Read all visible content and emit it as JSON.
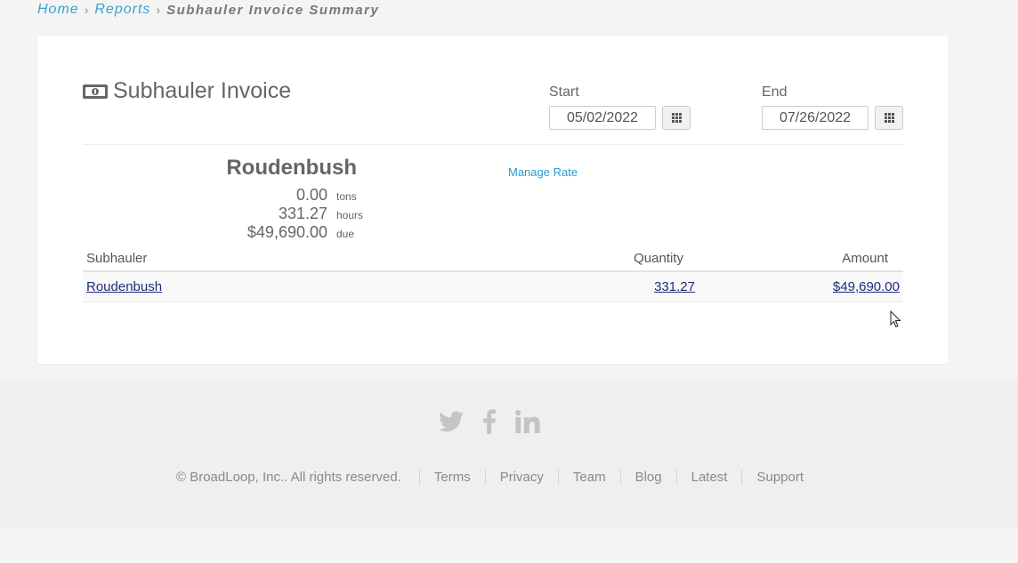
{
  "breadcrumb": {
    "home": "Home",
    "reports": "Reports",
    "current": "Subhauler Invoice Summary",
    "separator": "›"
  },
  "header": {
    "title": "Subhauler Invoice",
    "icon": "money-icon"
  },
  "dates": {
    "start_label": "Start",
    "start_value": "05/02/2022",
    "end_label": "End",
    "end_value": "07/26/2022",
    "calendar_icon": "calendar-grid-icon"
  },
  "summary": {
    "name": "Roudenbush",
    "tons_value": "0.00",
    "tons_unit": "tons",
    "hours_value": "331.27",
    "hours_unit": "hours",
    "due_value": "$49,690.00",
    "due_unit": "due",
    "manage_rate": "Manage Rate"
  },
  "table": {
    "columns": [
      "Subhauler",
      "Quantity",
      "Amount"
    ],
    "rows": [
      {
        "subhauler": "Roudenbush",
        "quantity": "331.27",
        "amount": "$49,690.00"
      }
    ]
  },
  "footer": {
    "social": [
      "twitter-icon",
      "facebook-icon",
      "linkedin-icon"
    ],
    "copyright": "© BroadLoop, Inc.. All rights reserved.",
    "links": [
      "Terms",
      "Privacy",
      "Team",
      "Blog",
      "Latest",
      "Support"
    ]
  },
  "colors": {
    "link_blue": "#3aa3cf",
    "table_link": "#1f2a7a",
    "background": "#f4f4f4"
  }
}
